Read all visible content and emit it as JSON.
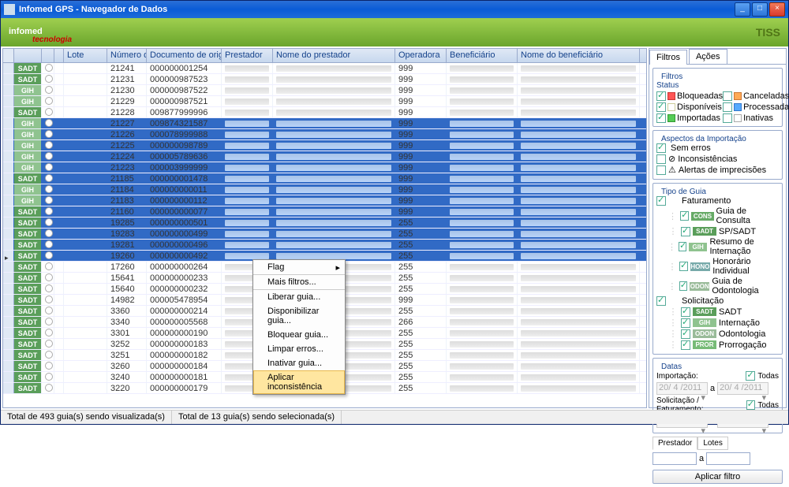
{
  "window": {
    "title": "Infomed GPS - Navegador de Dados"
  },
  "banner": {
    "logo": "infomed",
    "sublogo": "tecnologia",
    "right": "TISS"
  },
  "columns": [
    "",
    "",
    "",
    "",
    "Lote",
    "Número da guia",
    "Documento de origem",
    "Prestador",
    "Nome do prestador",
    "Operadora",
    "Beneficiário",
    "Nome do beneficiário"
  ],
  "rows": [
    {
      "tag": "SADT",
      "num": "21241",
      "doc": "000000001254",
      "op": "999",
      "sel": false
    },
    {
      "tag": "SADT",
      "num": "21231",
      "doc": "000000987523",
      "op": "999",
      "sel": false
    },
    {
      "tag": "GIH",
      "num": "21230",
      "doc": "000000987522",
      "op": "999",
      "sel": false
    },
    {
      "tag": "GIH",
      "num": "21229",
      "doc": "000000987521",
      "op": "999",
      "sel": false
    },
    {
      "tag": "SADT",
      "num": "21228",
      "doc": "009877999996",
      "op": "999",
      "sel": false
    },
    {
      "tag": "GIH",
      "num": "21227",
      "doc": "009874321587",
      "op": "999",
      "sel": true
    },
    {
      "tag": "GIH",
      "num": "21226",
      "doc": "000078999988",
      "op": "999",
      "sel": true
    },
    {
      "tag": "GIH",
      "num": "21225",
      "doc": "000000098789",
      "op": "999",
      "sel": true
    },
    {
      "tag": "GIH",
      "num": "21224",
      "doc": "000005789636",
      "op": "999",
      "sel": true
    },
    {
      "tag": "GIH",
      "num": "21223",
      "doc": "000003999999",
      "op": "999",
      "sel": true
    },
    {
      "tag": "SADT",
      "num": "21185",
      "doc": "000000001478",
      "op": "999",
      "sel": true
    },
    {
      "tag": "GIH",
      "num": "21184",
      "doc": "000000000011",
      "op": "999",
      "sel": true
    },
    {
      "tag": "GIH",
      "num": "21183",
      "doc": "000000000112",
      "op": "999",
      "sel": true
    },
    {
      "tag": "SADT",
      "num": "21160",
      "doc": "000000000077",
      "op": "999",
      "sel": true
    },
    {
      "tag": "SADT",
      "num": "19285",
      "doc": "000000000501",
      "op": "255",
      "sel": true
    },
    {
      "tag": "SADT",
      "num": "19283",
      "doc": "000000000499",
      "op": "255",
      "sel": true
    },
    {
      "tag": "SADT",
      "num": "19281",
      "doc": "000000000496",
      "op": "255",
      "sel": true
    },
    {
      "tag": "SADT",
      "num": "19260",
      "doc": "000000000492",
      "op": "255",
      "sel": true,
      "ptr": true
    },
    {
      "tag": "SADT",
      "num": "17260",
      "doc": "000000000264",
      "op": "255",
      "sel": false
    },
    {
      "tag": "SADT",
      "num": "15641",
      "doc": "000000000233",
      "op": "255",
      "sel": false
    },
    {
      "tag": "SADT",
      "num": "15640",
      "doc": "000000000232",
      "op": "255",
      "sel": false
    },
    {
      "tag": "SADT",
      "num": "14982",
      "doc": "000005478954",
      "op": "999",
      "sel": false
    },
    {
      "tag": "SADT",
      "num": "3360",
      "doc": "000000000214",
      "op": "255",
      "sel": false
    },
    {
      "tag": "SADT",
      "num": "3340",
      "doc": "000000005568",
      "op": "266",
      "sel": false
    },
    {
      "tag": "SADT",
      "num": "3301",
      "doc": "000000000190",
      "op": "255",
      "sel": false
    },
    {
      "tag": "SADT",
      "num": "3252",
      "doc": "000000000183",
      "op": "255",
      "sel": false
    },
    {
      "tag": "SADT",
      "num": "3251",
      "doc": "000000000182",
      "op": "255",
      "sel": false
    },
    {
      "tag": "SADT",
      "num": "3260",
      "doc": "000000000184",
      "op": "255",
      "sel": false
    },
    {
      "tag": "SADT",
      "num": "3240",
      "doc": "000000000181",
      "op": "255",
      "sel": false
    },
    {
      "tag": "SADT",
      "num": "3220",
      "doc": "000000000179",
      "op": "255",
      "sel": false
    }
  ],
  "context_menu": {
    "items": [
      {
        "label": "Flag",
        "sub": true,
        "sep": true
      },
      {
        "label": "Mais filtros...",
        "sep": true
      },
      {
        "label": "Liberar guia..."
      },
      {
        "label": "Disponibilizar guia..."
      },
      {
        "label": "Bloquear guia..."
      },
      {
        "label": "Limpar erros..."
      },
      {
        "label": "Inativar guia..."
      },
      {
        "label": "Aplicar inconsistência",
        "hover": true
      }
    ]
  },
  "side": {
    "tabs": [
      "Filtros",
      "Ações"
    ],
    "filtros": {
      "legend": "Filtros",
      "status_legend": "Status",
      "status": [
        {
          "label": "Bloqueadas",
          "ck": true,
          "cls": "red"
        },
        {
          "label": "Canceladas",
          "ck": false,
          "cls": "ora"
        },
        {
          "label": "Disponíveis",
          "ck": true,
          "cls": "yel"
        },
        {
          "label": "Processadas",
          "ck": false,
          "cls": "blu"
        },
        {
          "label": "Importadas",
          "ck": true,
          "cls": "grn"
        },
        {
          "label": "Inativas",
          "ck": false,
          "cls": "gry"
        }
      ],
      "aspectos_legend": "Aspectos da Importação",
      "aspectos": [
        {
          "label": "Sem erros",
          "ck": true,
          "icon": ""
        },
        {
          "label": "Inconsistências",
          "ck": false,
          "icon": "⊘"
        },
        {
          "label": "Alertas de imprecisões",
          "ck": false,
          "icon": "⚠"
        }
      ],
      "tipo_legend": "Tipo de Guia",
      "fat_label": "Faturamento",
      "sol_label": "Solicitação",
      "tipos_fat": [
        {
          "tag": "CONS",
          "label": "Guia de Consulta"
        },
        {
          "tag": "SADT",
          "label": "SP/SADT"
        },
        {
          "tag": "GIH",
          "label": "Resumo de Internação"
        },
        {
          "tag": "HONO",
          "label": "Honorário Individual"
        },
        {
          "tag": "ODON",
          "label": "Guia de Odontologia"
        }
      ],
      "tipos_sol": [
        {
          "tag": "SADT",
          "label": "SADT"
        },
        {
          "tag": "GIH",
          "label": "Internação"
        },
        {
          "tag": "ODON",
          "label": "Odontologia"
        },
        {
          "tag": "PROR",
          "label": "Prorrogação"
        }
      ],
      "datas_legend": "Datas",
      "importacao_label": "Importação:",
      "solfat_label": "Solicitação / Faturamento:",
      "todas_label": "Todas",
      "date_val": "20/ 4 /2011",
      "a_label": "a",
      "prestador_tabs": [
        "Prestador",
        "Lotes"
      ],
      "aplicar_label": "Aplicar filtro"
    }
  },
  "statusbar": {
    "left": "Total de 493 guia(s) sendo visualizada(s)",
    "right": "Total de 13 guia(s) sendo selecionada(s)"
  }
}
